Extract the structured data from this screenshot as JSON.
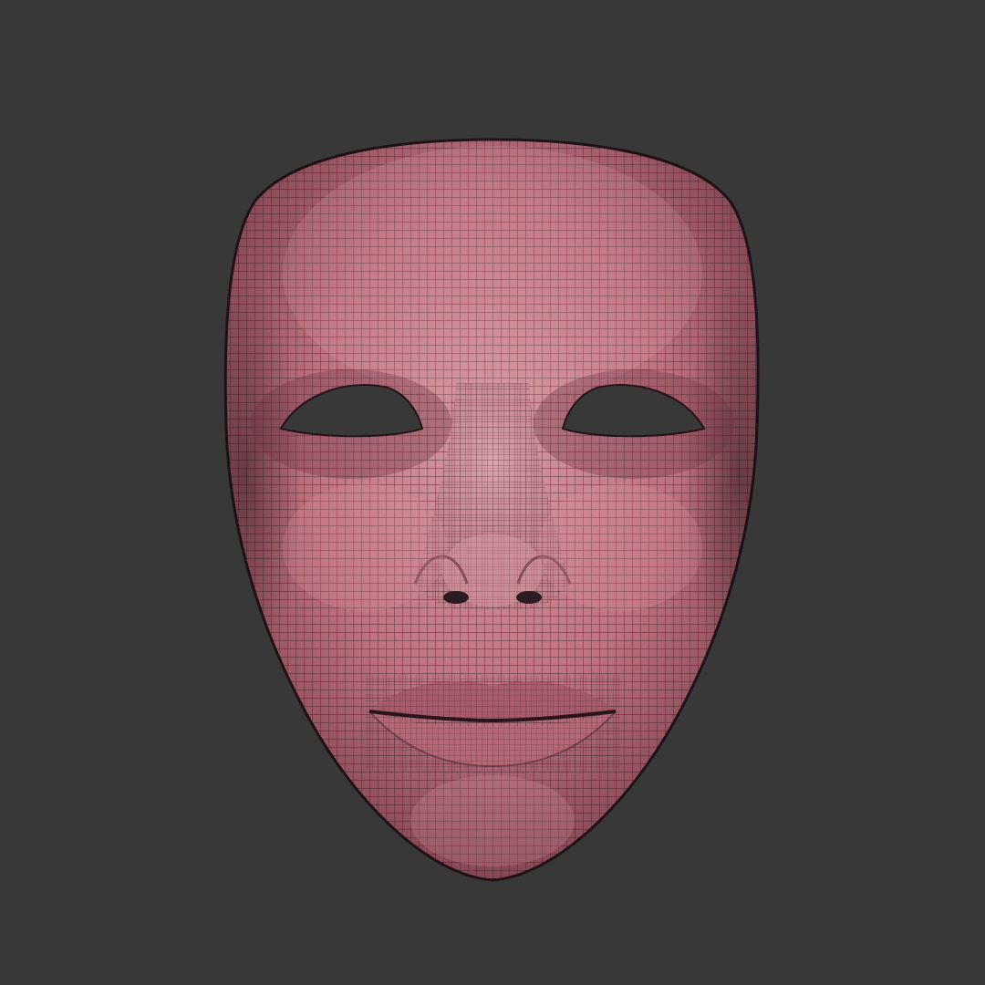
{
  "scene": {
    "subject": "mask-face-wireframe",
    "colors": {
      "background": "#383838",
      "skin": "#b86a7a",
      "skin_light": "#d48c98",
      "skin_dark": "#7e4352",
      "wire": "#2b1a1f",
      "hole": "#383838"
    }
  }
}
